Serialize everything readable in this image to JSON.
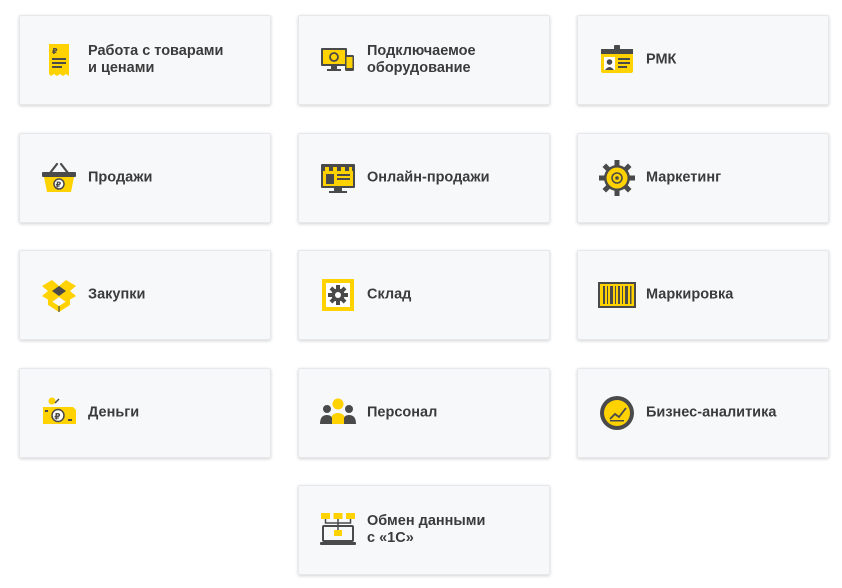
{
  "colors": {
    "accent": "#ffd200",
    "dark": "#4a4a4a",
    "card_bg": "#f7f8fa"
  },
  "tiles": [
    {
      "label": "Работа с товарами\nи ценами",
      "icon": "price-tag-icon"
    },
    {
      "label": "Подключаемое\nоборудование",
      "icon": "monitor-devices-icon"
    },
    {
      "label": "РМК",
      "icon": "id-card-icon"
    },
    {
      "label": "Продажи",
      "icon": "basket-icon"
    },
    {
      "label": "Онлайн-продажи",
      "icon": "online-store-icon"
    },
    {
      "label": "Маркетинг",
      "icon": "gear-icon"
    },
    {
      "label": "Закупки",
      "icon": "open-box-icon"
    },
    {
      "label": "Склад",
      "icon": "warehouse-icon"
    },
    {
      "label": "Маркировка",
      "icon": "barcode-icon"
    },
    {
      "label": "Деньги",
      "icon": "money-icon"
    },
    {
      "label": "Персонал",
      "icon": "people-icon"
    },
    {
      "label": "Бизнес-аналитика",
      "icon": "analytics-icon"
    },
    {
      "label": "Обмен данными\nс «1С»",
      "icon": "data-exchange-icon"
    }
  ]
}
